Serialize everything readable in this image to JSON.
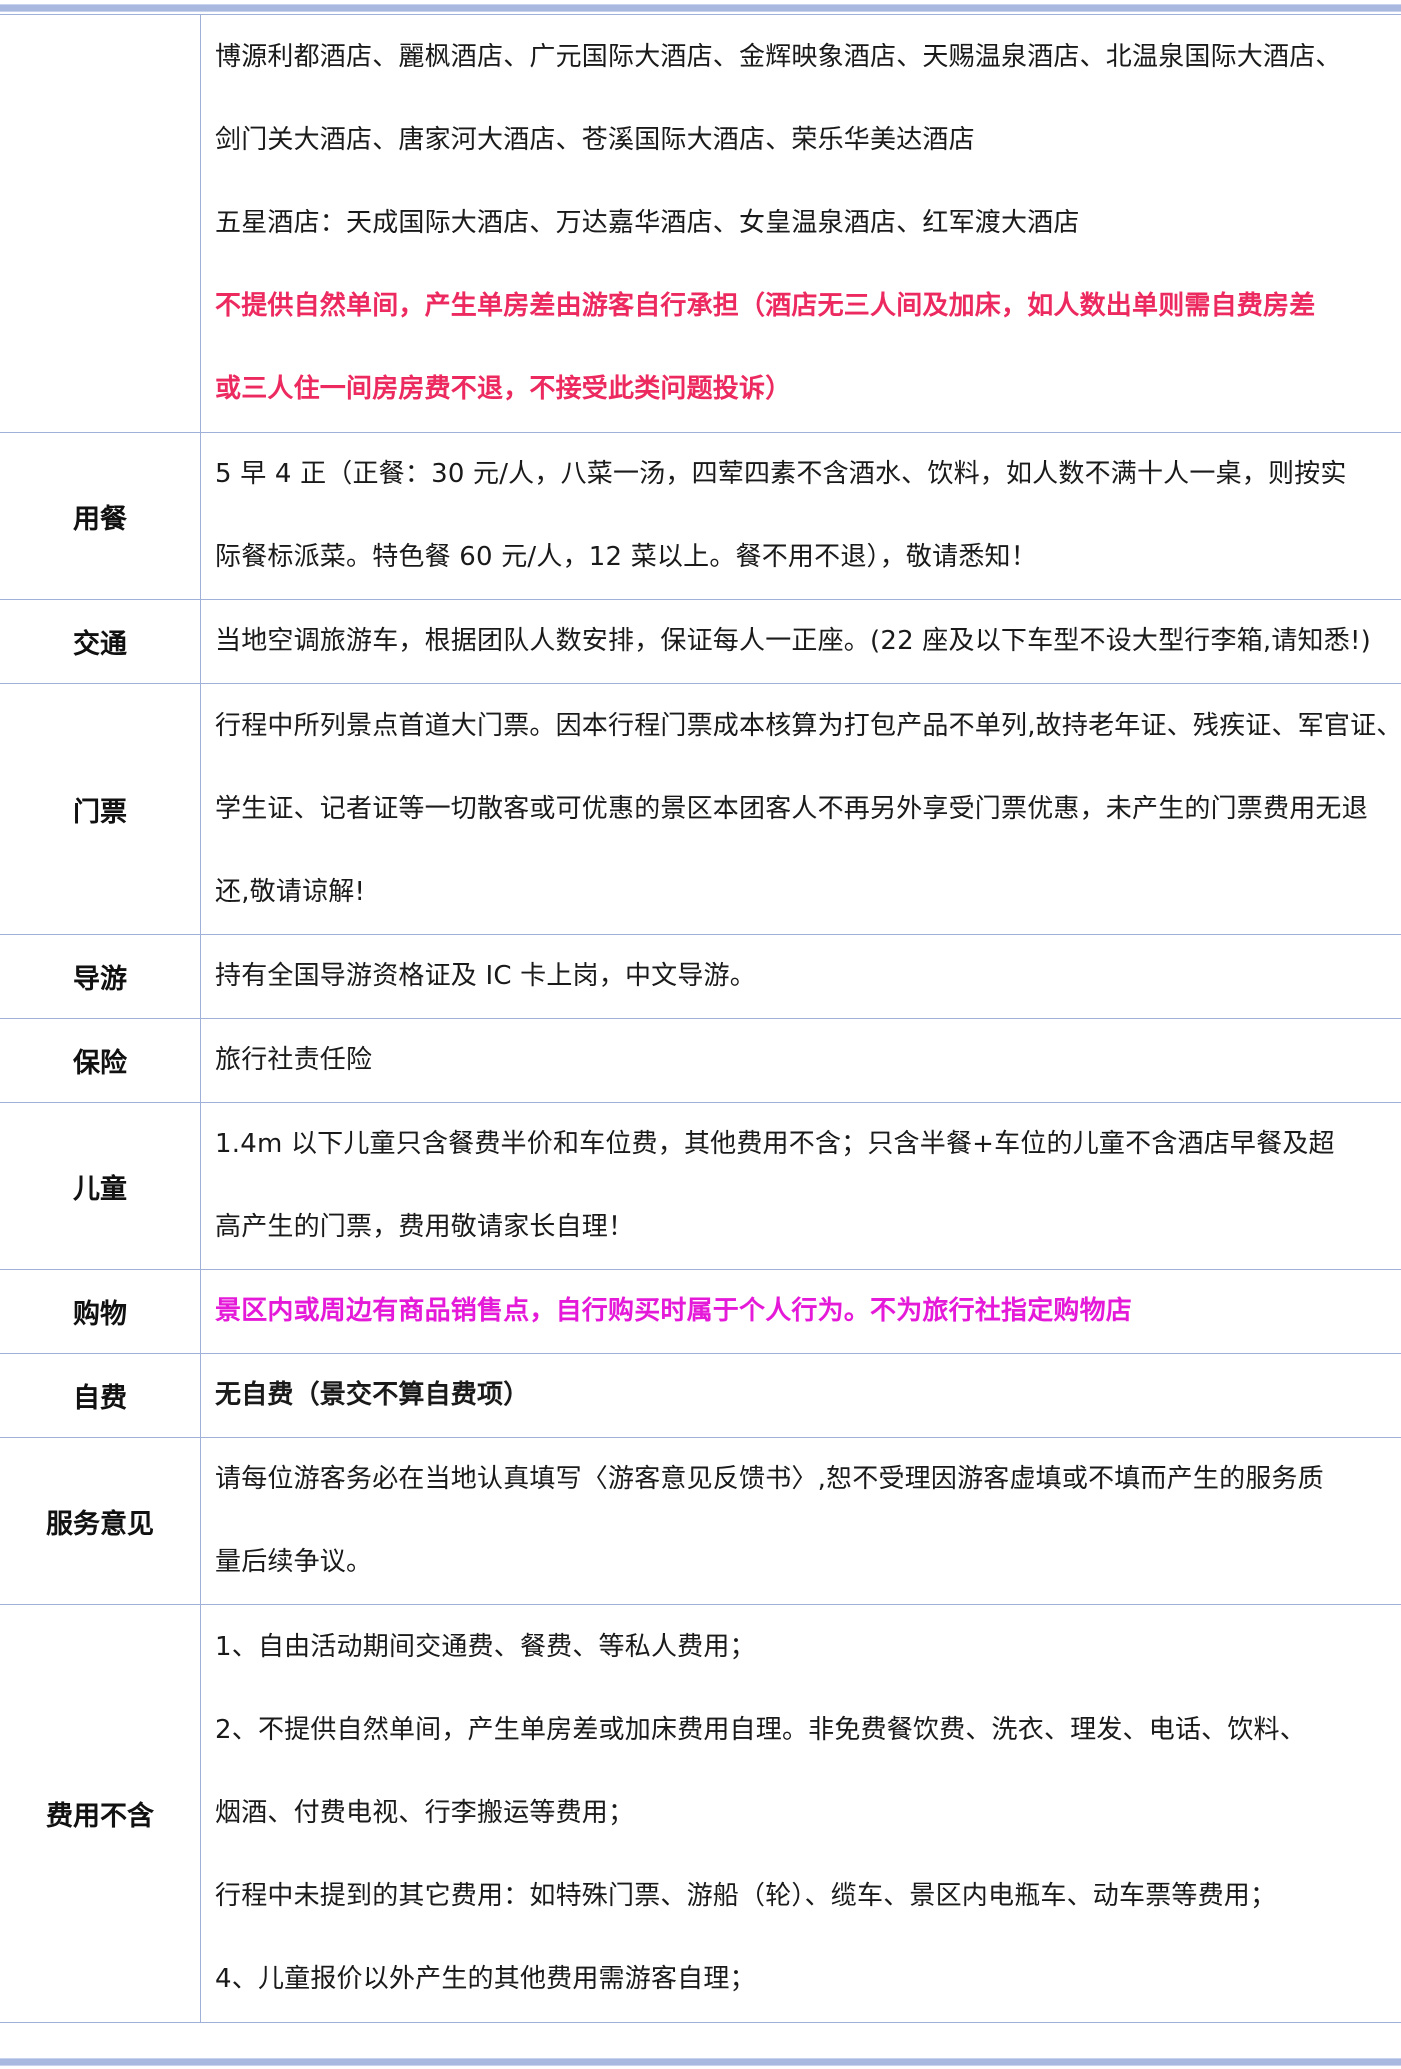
{
  "rows": {
    "hotel": {
      "label": "",
      "lines": [
        "博源利都酒店、麗枫酒店、广元国际大酒店、金辉映象酒店、天赐温泉酒店、北温泉国际大酒店、",
        "剑门关大酒店、唐家河大酒店、苍溪国际大酒店、荣乐华美达酒店",
        "五星酒店：天成国际大酒店、万达嘉华酒店、女皇温泉酒店、红军渡大酒店",
        "不提供自然单间，产生单房差由游客自行承担（酒店无三人间及加床，如人数出单则需自费房差",
        "或三人住一间房房费不退，不接受此类问题投诉）"
      ]
    },
    "meal": {
      "label": "用餐",
      "lines": [
        "5 早 4 正（正餐：30 元/人，八菜一汤，四荤四素不含酒水、饮料，如人数不满十人一桌，则按实",
        "际餐标派菜。特色餐  60 元/人，12 菜以上。餐不用不退），敬请悉知！"
      ]
    },
    "transport": {
      "label": "交通",
      "lines": [
        "当地空调旅游车，根据团队人数安排，保证每人一正座。(22 座及以下车型不设大型行李箱,请知悉!)"
      ]
    },
    "tickets": {
      "label": "门票",
      "lines": [
        "行程中所列景点首道大门票。因本行程门票成本核算为打包产品不单列,故持老年证、残疾证、军官证、",
        "学生证、记者证等一切散客或可优惠的景区本团客人不再另外享受门票优惠，未产生的门票费用无退",
        "还,敬请谅解!"
      ]
    },
    "guide": {
      "label": "导游",
      "lines": [
        "持有全国导游资格证及 IC 卡上岗，中文导游。"
      ]
    },
    "insurance": {
      "label": "保险",
      "lines": [
        "旅行社责任险"
      ]
    },
    "children": {
      "label": "儿童",
      "lines": [
        "1.4m 以下儿童只含餐费半价和车位费，其他费用不含；只含半餐+车位的儿童不含酒店早餐及超",
        "高产生的门票，费用敬请家长自理！"
      ]
    },
    "shopping": {
      "label": "购物",
      "lines": [
        "景区内或周边有商品销售点，自行购买时属于个人行为。不为旅行社指定购物店"
      ]
    },
    "optional": {
      "label": "自费",
      "lines": [
        "无自费（景交不算自费项）"
      ]
    },
    "feedback": {
      "label": "服务意见",
      "lines": [
        "请每位游客务必在当地认真填写〈游客意见反馈书〉,恕不受理因游客虚填或不填而产生的服务质",
        "量后续争议。"
      ]
    },
    "excluded": {
      "label": "费用不含",
      "lines": [
        "1、自由活动期间交通费、餐费、等私人费用；",
        "2、不提供自然单间，产生单房差或加床费用自理。非免费餐饮费、洗衣、理发、电话、饮料、",
        "烟酒、付费电视、行李搬运等费用；",
        "行程中未提到的其它费用：如特殊门票、游船（轮）、缆车、景区内电瓶车、动车票等费用；",
        "4、儿童报价以外产生的其他费用需游客自理；"
      ]
    }
  },
  "colors": {
    "border": "#9fb1d8",
    "bar": "#a8b8de",
    "warning_red": "#ec2a60",
    "shopping_magenta": "#e51ad9"
  }
}
